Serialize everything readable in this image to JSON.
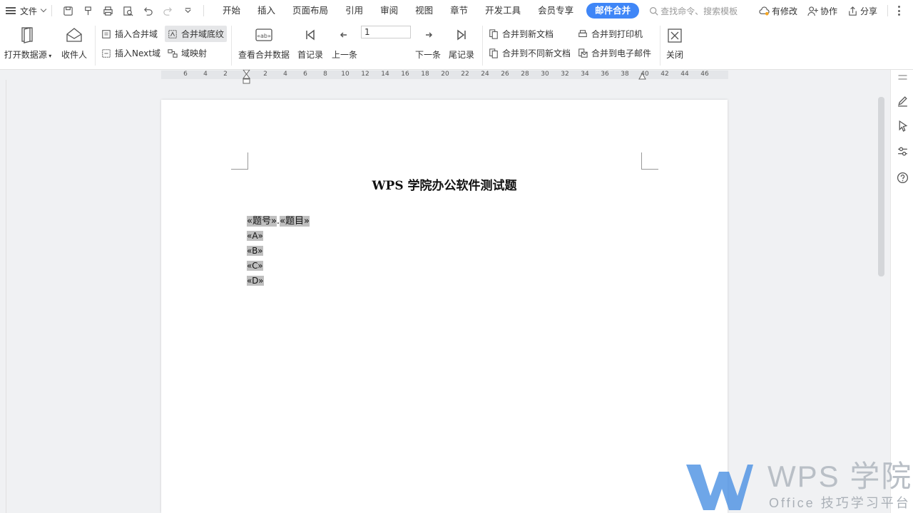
{
  "menubar": {
    "file_label": "文件",
    "tabs": [
      "开始",
      "插入",
      "页面布局",
      "引用",
      "审阅",
      "视图",
      "章节",
      "开发工具",
      "会员专享"
    ],
    "active_tab": "邮件合并",
    "search_placeholder": "查找命令、搜索模板",
    "modified_label": "有修改",
    "collab_label": "协作",
    "share_label": "分享"
  },
  "ribbon": {
    "open_datasource": "打开数据源",
    "recipients": "收件人",
    "insert_merge_field": "插入合并域",
    "merge_field_shading": "合并域底纹",
    "insert_next_field": "插入Next域",
    "field_mapping": "域映射",
    "view_merged_data": "查看合并数据",
    "first_record": "首记录",
    "prev_record": "上一条",
    "record_number": "1",
    "next_record": "下一条",
    "last_record": "尾记录",
    "merge_to_new_doc": "合并到新文档",
    "merge_to_diff_docs": "合并到不同新文档",
    "merge_to_printer": "合并到打印机",
    "merge_to_email": "合并到电子邮件",
    "close": "关闭"
  },
  "ruler": {
    "ticks": [
      "6",
      "4",
      "2",
      "2",
      "4",
      "6",
      "8",
      "10",
      "12",
      "14",
      "16",
      "18",
      "20",
      "22",
      "24",
      "26",
      "28",
      "30",
      "32",
      "34",
      "36",
      "38",
      "40",
      "42",
      "44",
      "46"
    ]
  },
  "document": {
    "title": "WPS 学院办公软件测试题",
    "field_number": "«题号»",
    "separator": ".",
    "field_question": "«题目»",
    "field_a": "«A»",
    "field_b": "«B»",
    "field_c": "«C»",
    "field_d": "«D»"
  },
  "watermark": {
    "brand": "WPS 学院",
    "tagline": "Office 技巧学习平台"
  },
  "colors": {
    "accent": "#3f86f7",
    "field_shading": "#bfbfbf",
    "watermark_blue": "#4a90e2"
  }
}
